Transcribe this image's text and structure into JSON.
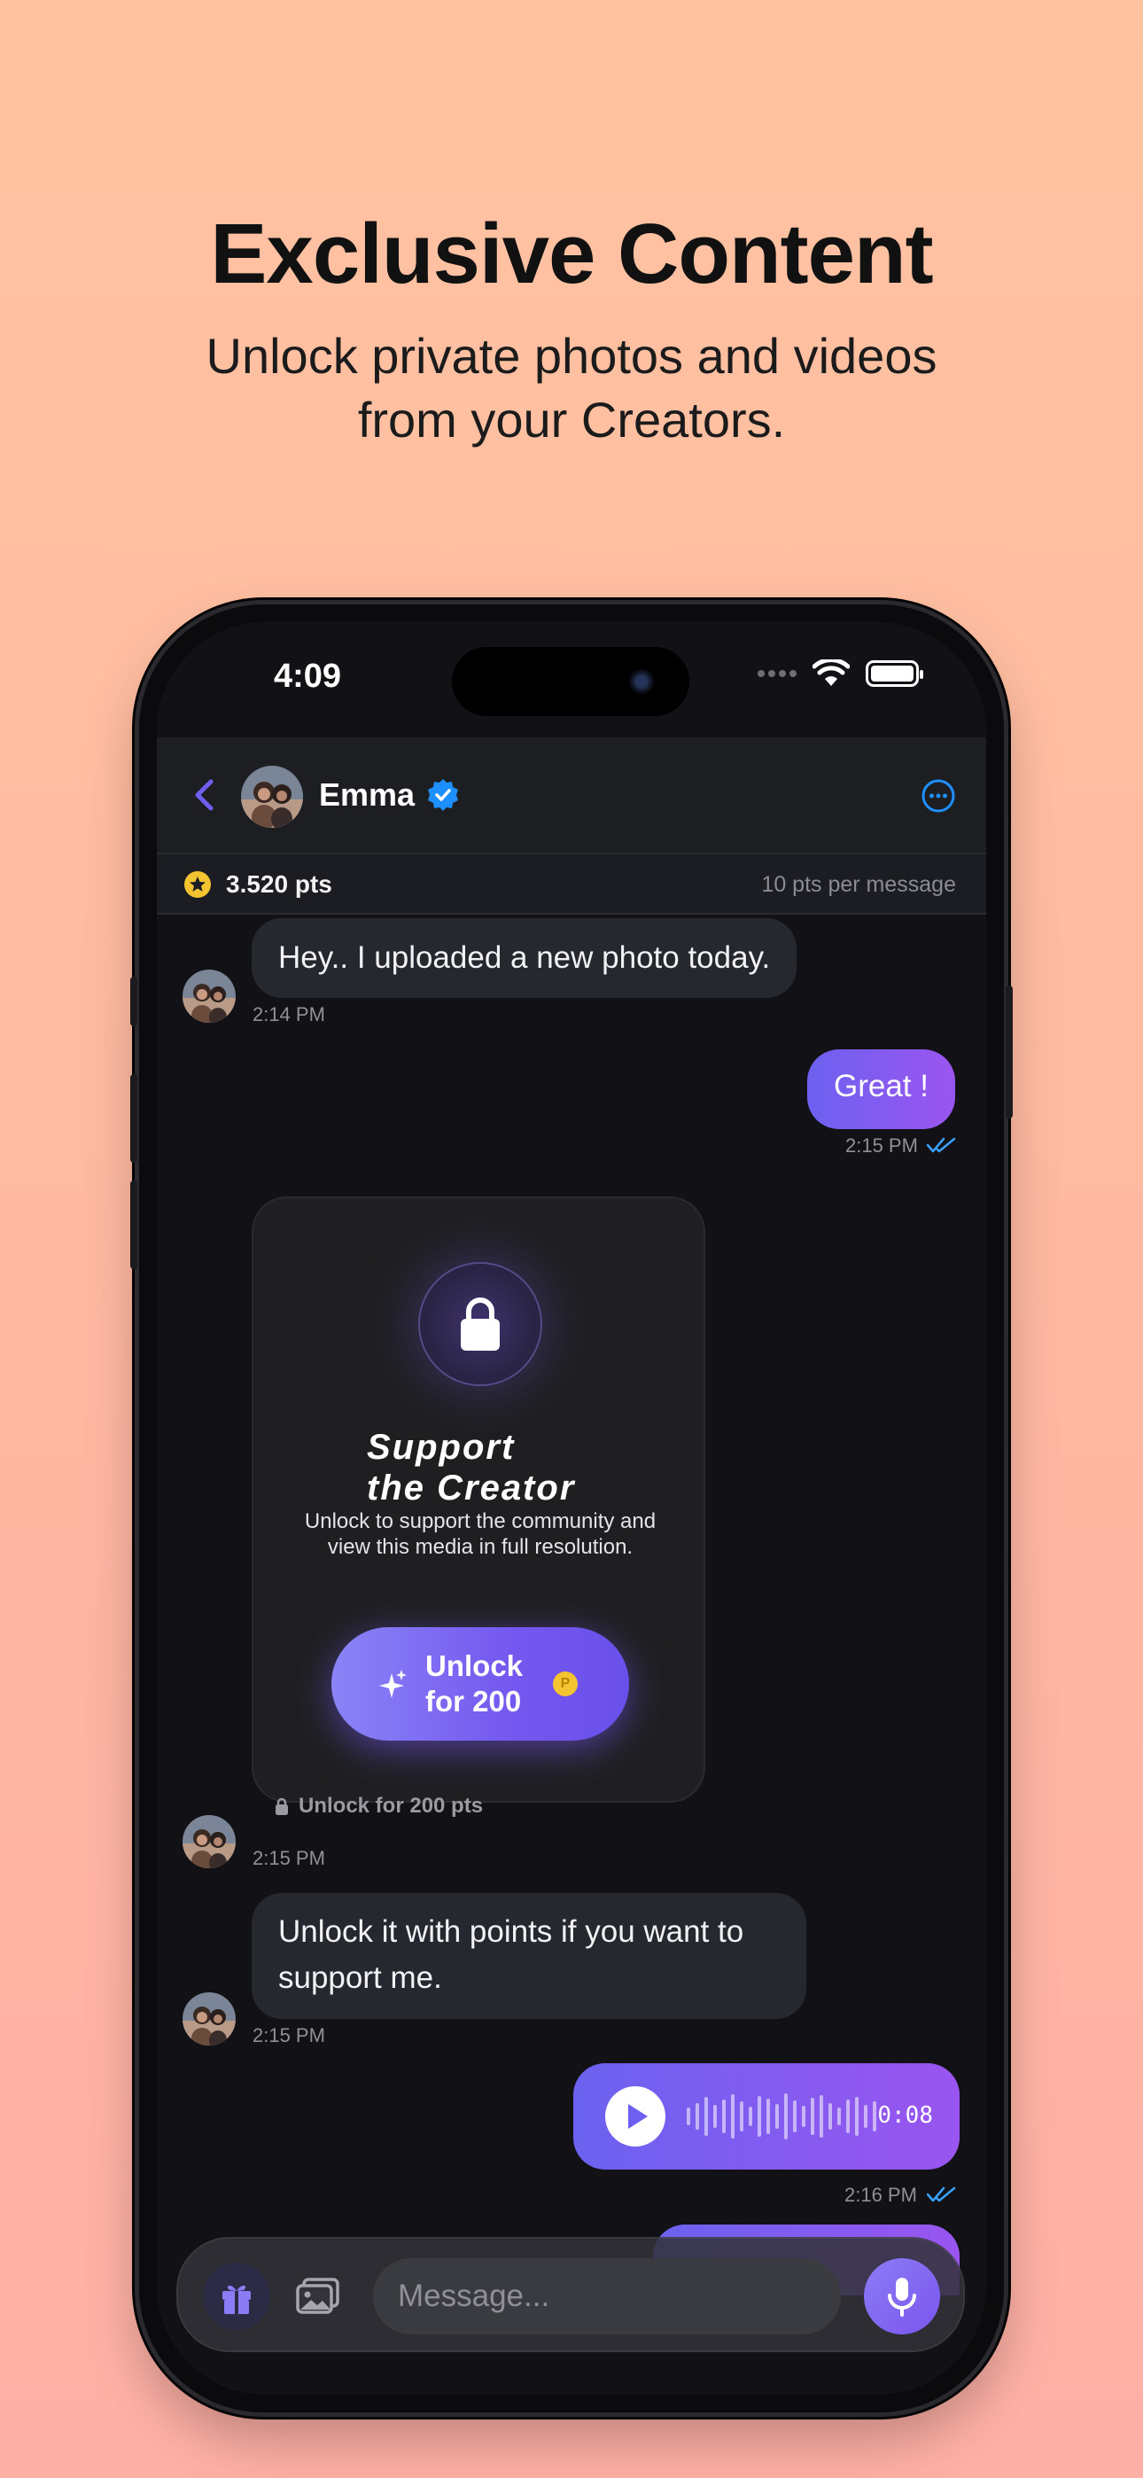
{
  "promo": {
    "headline": "Exclusive Content",
    "subline_1": "Unlock private photos and videos",
    "subline_2": "from your Creators."
  },
  "status_bar": {
    "time": "4:09",
    "icons": [
      "cellular-icon",
      "wifi-icon",
      "battery-icon"
    ]
  },
  "chat_header": {
    "name": "Emma",
    "verified": true,
    "icons": [
      "back-icon",
      "verified-badge-icon",
      "more-icon"
    ]
  },
  "points": {
    "balance": "3.520 pts",
    "rate": "10 pts per message"
  },
  "messages": {
    "m1": {
      "text": "Hey.. I uploaded a new photo today.",
      "time": "2:14 PM"
    },
    "m2": {
      "text": "Great !",
      "time": "2:15 PM"
    },
    "locked_media": {
      "title_line1": "Support",
      "title_line2": "the Creator",
      "description": "Unlock to support the community and view this media in full resolution.",
      "button_line1": "Unlock",
      "button_line2": "for 200",
      "coin_symbol": "P",
      "note": "Unlock for 200 pts",
      "time": "2:15 PM"
    },
    "m3": {
      "text": "Unlock it with points if you want to support me.",
      "time": "2:15 PM"
    },
    "voice": {
      "duration": "0:08",
      "time": "2:16 PM"
    }
  },
  "composer": {
    "placeholder": "Message..."
  },
  "colors": {
    "accent": "#7b5cf0",
    "link_blue": "#1e90ff",
    "read_tick": "#3aa0ff",
    "gold": "#f4c430",
    "background_peach": "#ffc3a1"
  }
}
